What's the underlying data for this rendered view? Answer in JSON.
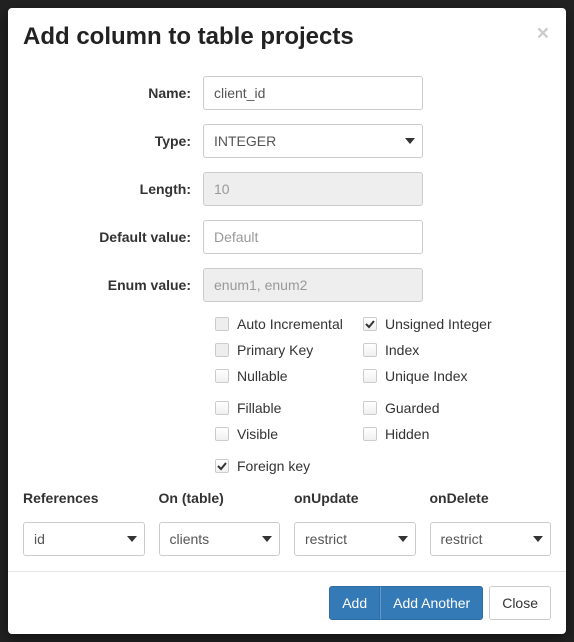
{
  "header": {
    "title": "Add column to table projects"
  },
  "labels": {
    "name": "Name:",
    "type": "Type:",
    "length": "Length:",
    "default_value": "Default value:",
    "enum_value": "Enum value:"
  },
  "fields": {
    "name": {
      "value": "client_id"
    },
    "type": {
      "value": "INTEGER"
    },
    "length": {
      "placeholder": "10"
    },
    "default_value": {
      "placeholder": "Default"
    },
    "enum_value": {
      "placeholder": "enum1, enum2"
    }
  },
  "checks": {
    "auto_incremental": {
      "label": "Auto Incremental",
      "checked": false,
      "disabled": true
    },
    "unsigned_integer": {
      "label": "Unsigned Integer",
      "checked": true,
      "disabled": false
    },
    "primary_key": {
      "label": "Primary Key",
      "checked": false,
      "disabled": true
    },
    "index": {
      "label": "Index",
      "checked": false,
      "disabled": false
    },
    "nullable": {
      "label": "Nullable",
      "checked": false,
      "disabled": false
    },
    "unique_index": {
      "label": "Unique Index",
      "checked": false,
      "disabled": false
    },
    "fillable": {
      "label": "Fillable",
      "checked": false,
      "disabled": false
    },
    "guarded": {
      "label": "Guarded",
      "checked": false,
      "disabled": false
    },
    "visible": {
      "label": "Visible",
      "checked": false,
      "disabled": false
    },
    "hidden": {
      "label": "Hidden",
      "checked": false,
      "disabled": false
    },
    "foreign_key": {
      "label": "Foreign key",
      "checked": true,
      "disabled": false
    }
  },
  "fk": {
    "headers": {
      "references": "References",
      "on_table": "On (table)",
      "on_update": "onUpdate",
      "on_delete": "onDelete"
    },
    "values": {
      "references": "id",
      "on_table": "clients",
      "on_update": "restrict",
      "on_delete": "restrict"
    }
  },
  "footer": {
    "add": "Add",
    "add_another": "Add Another",
    "close": "Close"
  }
}
